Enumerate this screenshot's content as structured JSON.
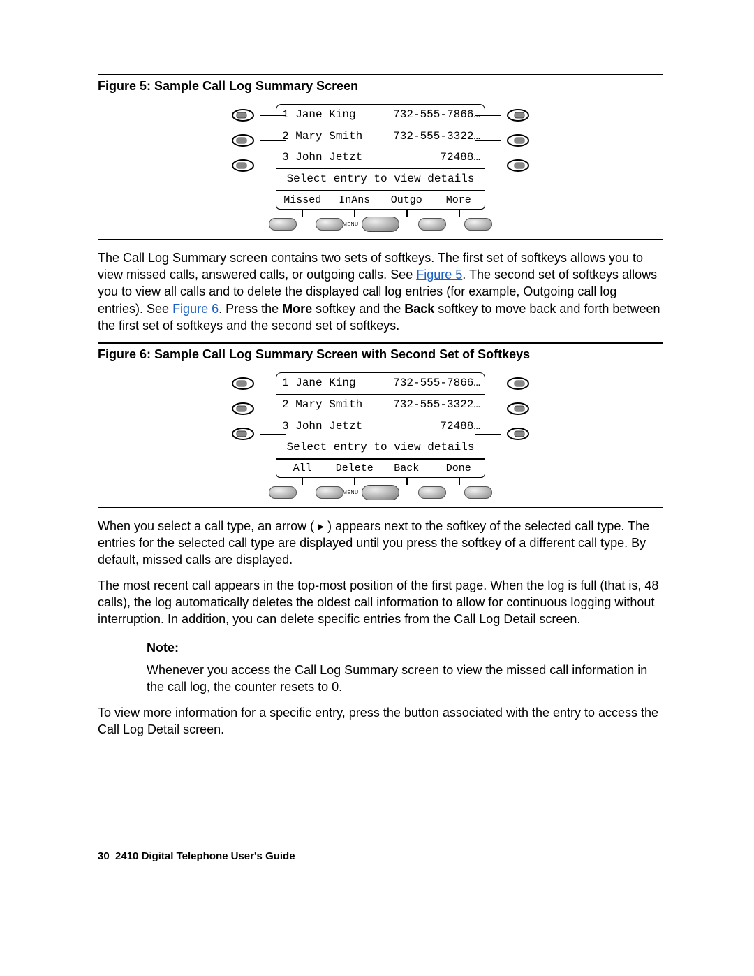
{
  "figure5": {
    "caption": "Figure 5: Sample Call Log Summary Screen",
    "entries": [
      {
        "idx": "1",
        "name": "Jane King",
        "number": "732-555-7866"
      },
      {
        "idx": "2",
        "name": "Mary Smith",
        "number": "732-555-3322"
      },
      {
        "idx": "3",
        "name": "John Jetzt",
        "number": "72488"
      }
    ],
    "hint": "Select entry to view details",
    "softkeys": [
      "Missed",
      "InAns",
      "Outgo",
      "More"
    ],
    "menu_label": "MENU"
  },
  "paragraph1_a": "The Call Log Summary screen contains two sets of softkeys. The first set of softkeys allows you to view missed calls, answered calls, or outgoing calls. See ",
  "link_fig5": "Figure 5",
  "paragraph1_b": ". The second set of softkeys allows you to view all calls and to delete the displayed call log entries (for example, Outgoing call log entries). See ",
  "link_fig6": "Figure 6",
  "paragraph1_c": ". Press the ",
  "bold_more": "More",
  "paragraph1_d": " softkey and the ",
  "bold_back": "Back",
  "paragraph1_e": " softkey to move back and forth between the first set of softkeys and the second set of softkeys.",
  "figure6": {
    "caption": "Figure 6: Sample Call Log Summary Screen with Second Set of Softkeys",
    "entries": [
      {
        "idx": "1",
        "name": "Jane King",
        "number": "732-555-7866"
      },
      {
        "idx": "2",
        "name": "Mary Smith",
        "number": "732-555-3322"
      },
      {
        "idx": "3",
        "name": "John Jetzt",
        "number": "72488"
      }
    ],
    "hint": "Select entry to view details",
    "softkeys": [
      "All",
      "Delete",
      "Back",
      "Done"
    ],
    "menu_label": "MENU"
  },
  "paragraph2": "When you select a call type, an arrow ( ▸ ) appears next to the softkey of the selected call type. The entries for the selected call type are displayed until you press the softkey of a different call type. By default, missed calls are displayed.",
  "paragraph3": "The most recent call appears in the top-most position of the first page. When the log is full (that is, 48 calls), the log automatically deletes the oldest call information to allow for continuous logging without interruption. In addition, you can delete specific entries from the Call Log Detail screen.",
  "note_label": "Note:",
  "note_body": "Whenever you access the Call Log Summary screen to view the missed call information in the call log, the counter resets to 0.",
  "paragraph4": "To view more information for a specific entry, press the button associated with the entry to access the Call Log Detail screen.",
  "footer_page": "30",
  "footer_title": "2410 Digital Telephone User's Guide"
}
